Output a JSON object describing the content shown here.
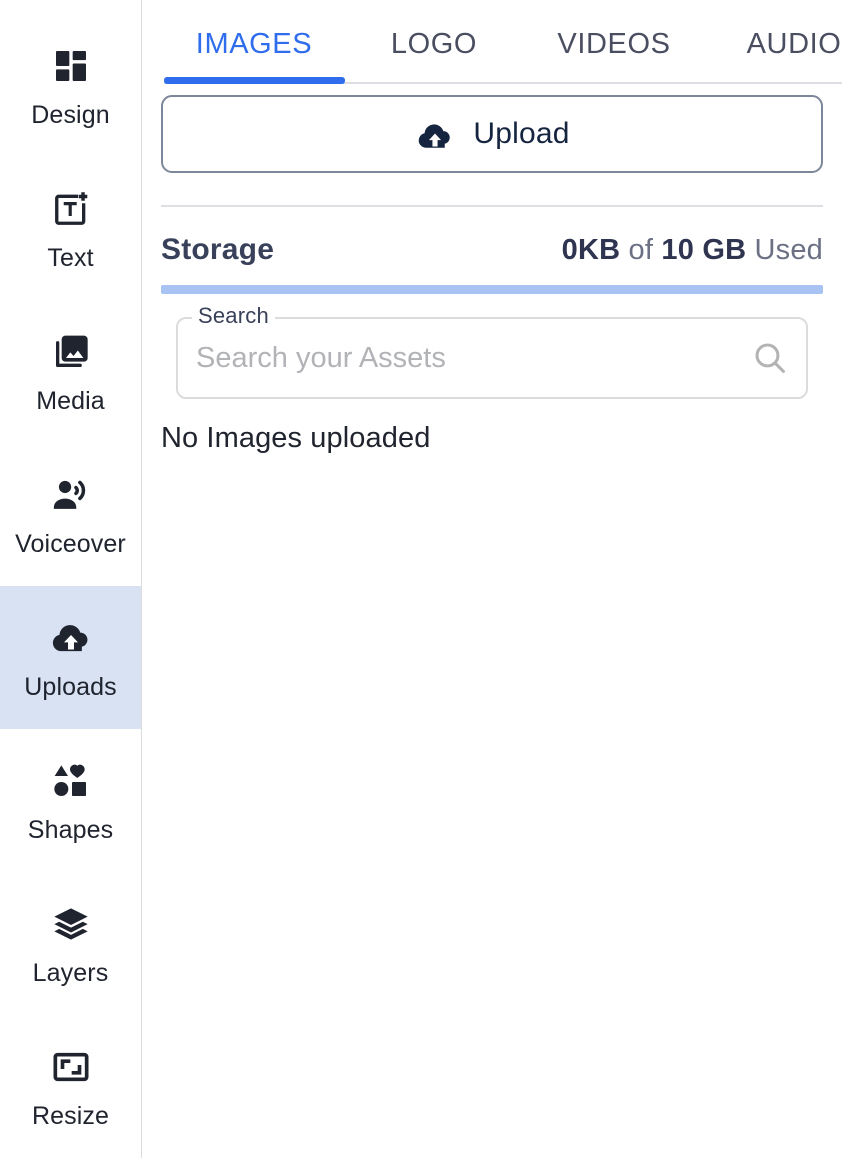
{
  "sidebar": {
    "items": [
      {
        "label": "Design",
        "icon": "dashboard-icon",
        "active": false
      },
      {
        "label": "Text",
        "icon": "text-add-icon",
        "active": false
      },
      {
        "label": "Media",
        "icon": "photo-library-icon",
        "active": false
      },
      {
        "label": "Voiceover",
        "icon": "voiceover-icon",
        "active": false
      },
      {
        "label": "Uploads",
        "icon": "cloud-upload-icon",
        "active": true
      },
      {
        "label": "Shapes",
        "icon": "shapes-icon",
        "active": false
      },
      {
        "label": "Layers",
        "icon": "layers-icon",
        "active": false
      },
      {
        "label": "Resize",
        "icon": "resize-icon",
        "active": false
      }
    ],
    "active_background": "#d8e2f3"
  },
  "tabs": {
    "items": [
      {
        "label": "IMAGES",
        "active": true
      },
      {
        "label": "LOGO",
        "active": false
      },
      {
        "label": "VIDEOS",
        "active": false
      },
      {
        "label": "AUDIO",
        "active": false
      }
    ],
    "active_color": "#2f6dec"
  },
  "upload": {
    "label": "Upload",
    "icon": "cloud-upload-icon"
  },
  "storage": {
    "title": "Storage",
    "used": "0KB",
    "of_label": "of",
    "total": "10 GB",
    "used_label": "Used",
    "bar_percent": 0,
    "bar_color": "#a9c2f4"
  },
  "search": {
    "legend": "Search",
    "placeholder": "Search your Assets",
    "value": "",
    "icon": "search-icon"
  },
  "content": {
    "empty_message": "No Images uploaded"
  }
}
